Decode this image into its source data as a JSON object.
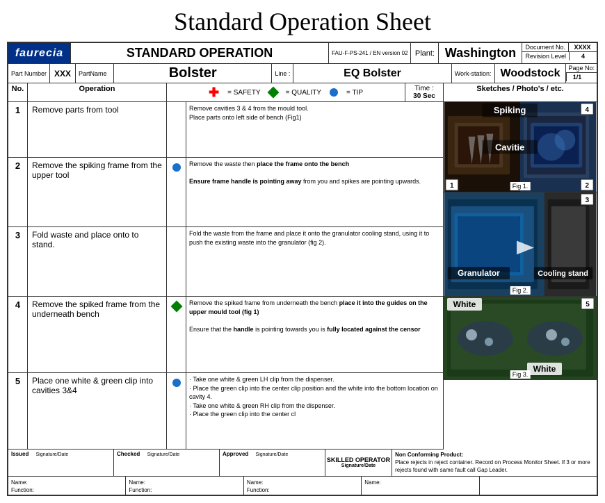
{
  "title": "Standard Operation Sheet",
  "header": {
    "logo": "faurecia",
    "std_op_label": "STANDARD OPERATION",
    "doc_ref": "FAU-F-PS-241 / EN version 02",
    "plant_label": "Plant:",
    "plant_name": "Washington",
    "doc_no_label": "Document No.",
    "doc_no_val": "XXXX",
    "rev_label": "Revision Level",
    "rev_val": "4",
    "part_number_label": "Part Number",
    "part_number_val": "XXX",
    "part_name_label": "PartName",
    "part_name_val": "Bolster",
    "line_label": "Line :",
    "line_val": "EQ Bolster",
    "workstation_label": "Work-station:",
    "workstation_val": "Woodstock",
    "page_label": "Page No:",
    "page_val": "1/1"
  },
  "col_headers": {
    "no": "No.",
    "operation": "Operation",
    "safety_label": "= SAFETY",
    "quality_label": "= QUALITY",
    "tip_label": "= TIP",
    "time_label": "Time :",
    "time_val": "30 Sec",
    "sketches_label": "Sketches / Photo's / etc."
  },
  "operations": [
    {
      "no": "1",
      "op": "Remove parts from tool",
      "symbol": "",
      "desc": "Remove cavities 3 & 4 from the mould tool.\nPlace parts onto left side of bench (Fig1)"
    },
    {
      "no": "2",
      "op": "Remove the spiking frame from the upper tool",
      "symbol": "circle",
      "desc_line1": "Remove the waste then place the frame onto the bench",
      "desc_line2": "Ensure frame handle is pointing away from you and spikes are pointing upwards."
    },
    {
      "no": "3",
      "op": "Fold waste and place onto to stand.",
      "symbol": "",
      "desc": "Fold the waste from the frame and place it onto the granulator cooling stand, using it to push the existing waste into the granulator (fig 2)."
    },
    {
      "no": "4",
      "op": "Remove the spiked frame from the underneath bench",
      "symbol": "diamond",
      "desc_line1": "Remove the spiked frame from underneath the bench place it into the guides on the upper mould tool (fig 1)",
      "desc_line2": "Ensure that the handle is pointing towards you is fully located against the censor"
    },
    {
      "no": "5",
      "op": "Place one white & green clip into cavities 3&4",
      "symbol": "circle",
      "desc": "· Take one white & green LH clip from the dispenser.\n· Place the green clip into the center clip position and the white into the bottom location on cavity 4.\n· Take one white & green RH clip from the dispenser.\n· Place the green clip into the center cl"
    }
  ],
  "photos": [
    {
      "label1": "Spiking",
      "label2": "Cavitie",
      "num_left": "1",
      "num_right": "2",
      "fig_label": "Fig 1.",
      "panel_num": "4"
    },
    {
      "label1": "Granulator",
      "label2": "Cooling stand",
      "fig_label": "Fig 2.",
      "panel_num": "3"
    },
    {
      "label1": "White",
      "label2": "White",
      "fig_label": "Fig 3.",
      "panel_num": "5"
    }
  ],
  "footer": {
    "issued_label": "Issued",
    "issued_sig": "Signature/Date",
    "checked_label": "Checked",
    "checked_sig": "Signature/Date",
    "approved_label": "Approved",
    "approved_sig": "Signature/Date",
    "skilled_label": "SKILLED OPERATOR",
    "skilled_sig": "Signature/Date",
    "non_conf_label": "Non Conforming Product:",
    "non_conf_text": "Place rejects in reject container. Record on Process Monitor Sheet. If 3 or more rejects found with same fault call Gap Leader.",
    "name_label": "Name:",
    "function_label": "Function:"
  }
}
